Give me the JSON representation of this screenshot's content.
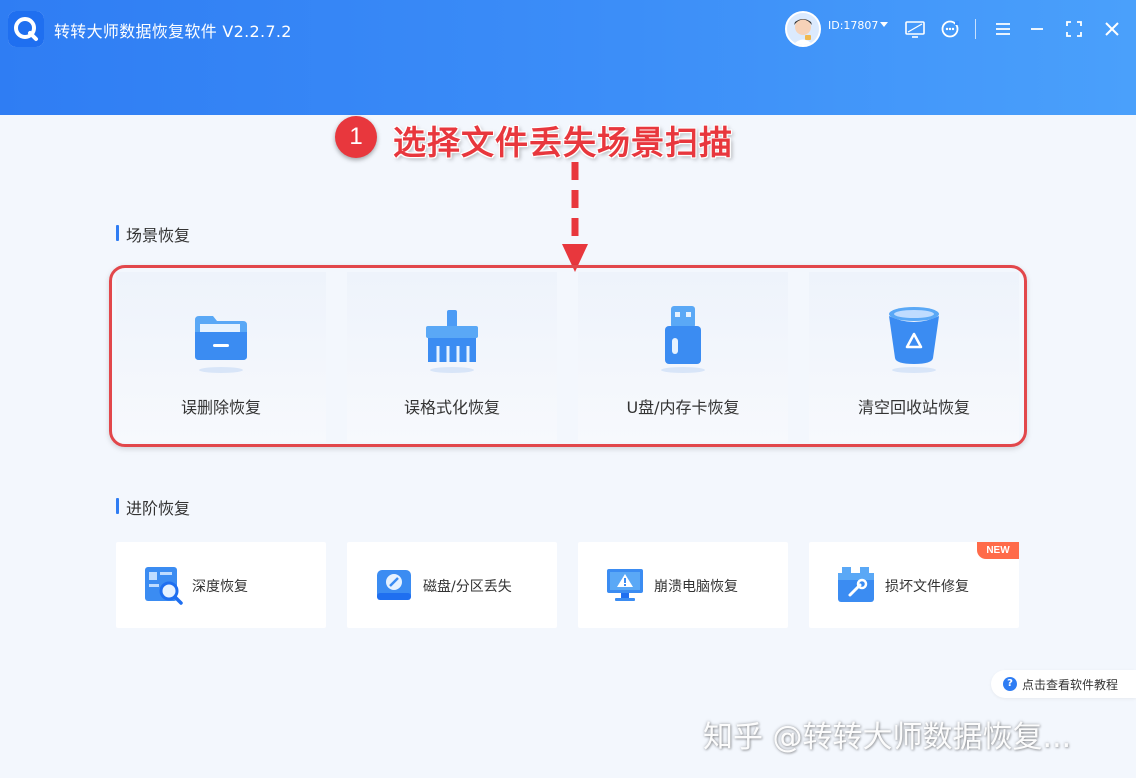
{
  "header": {
    "app_title": "转转大师数据恢复软件 V2.2.7.2",
    "user_id": "ID:17807",
    "icons": [
      "app-logo",
      "avatar",
      "dropdown-caret",
      "monitor-icon",
      "support-icon",
      "menu-icon",
      "minimize-icon",
      "maximize-icon",
      "close-icon"
    ]
  },
  "annotation": {
    "step_number": "1",
    "step_text": "选择文件丢失场景扫描",
    "color": "#e8373d"
  },
  "scene_section": {
    "title": "场景恢复",
    "cards": [
      {
        "label": "误删除恢复",
        "icon": "folder-icon"
      },
      {
        "label": "误格式化恢复",
        "icon": "broom-icon"
      },
      {
        "label": "U盘/内存卡恢复",
        "icon": "usb-drive-icon"
      },
      {
        "label": "清空回收站恢复",
        "icon": "recycle-bin-icon"
      }
    ]
  },
  "advanced_section": {
    "title": "进阶恢复",
    "cards": [
      {
        "label": "深度恢复",
        "icon": "deep-scan-icon"
      },
      {
        "label": "磁盘/分区丢失",
        "icon": "disk-icon"
      },
      {
        "label": "崩溃电脑恢复",
        "icon": "crashed-computer-icon"
      },
      {
        "label": "损坏文件修复",
        "icon": "file-repair-icon",
        "badge": "NEW"
      }
    ]
  },
  "tutorial": {
    "label": "点击查看软件教程",
    "icon_text": "?"
  },
  "watermark": "知乎 @转转大师数据恢复...",
  "colors": {
    "accent": "#2f7df3",
    "highlight": "#e8373d",
    "background": "#f3f7fd",
    "new_badge": "#ff6b4a"
  }
}
